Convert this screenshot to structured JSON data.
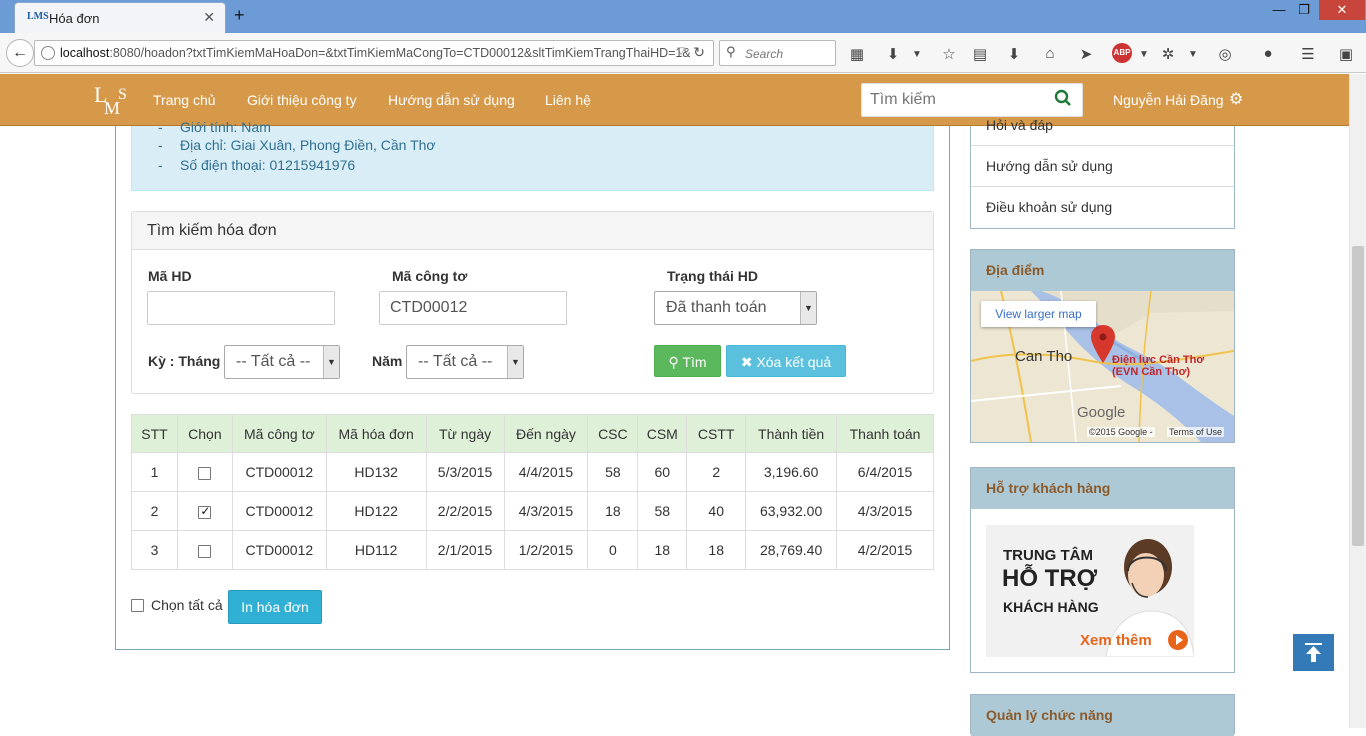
{
  "browser": {
    "tab_title": "Hóa đơn",
    "tab_favicon": "LMS",
    "url_host": "localhost",
    "url_rest": ":8080/hoadon?txtTimKiemMaHoaDon=&txtTimKiemMaCongTo=CTD00012&sltTimKiemTrangThaiHD=1&",
    "search_placeholder": "Search",
    "adblock_label": "ABP"
  },
  "header": {
    "nav": [
      "Trang chủ",
      "Giới thiệu công ty",
      "Hướng dẫn sử dụng",
      "Liên hệ"
    ],
    "search_placeholder": "Tìm kiếm",
    "user_name": "Nguyễn Hải Đăng"
  },
  "info": {
    "lines": [
      "Giới tính: Nam",
      "Địa chỉ: Giai Xuân, Phong Điền, Cần Thơ",
      "Số điện thoại: 01215941976"
    ]
  },
  "search_form": {
    "title": "Tìm kiếm hóa đơn",
    "ma_hd_label": "Mã HD",
    "ma_hd_value": "",
    "ma_cong_to_label": "Mã công tơ",
    "ma_cong_to_value": "CTD00012",
    "trang_thai_label": "Trạng thái HD",
    "trang_thai_value": "Đã thanh toán",
    "ky_label": "Kỳ : Tháng",
    "thang_value": "-- Tất cả --",
    "nam_label": "Năm",
    "nam_value": "-- Tất cả --",
    "search_button": "Tìm",
    "clear_button": "Xóa kết quả"
  },
  "table": {
    "headers": [
      "STT",
      "Chọn",
      "Mã công tơ",
      "Mã hóa đơn",
      "Từ ngày",
      "Đến ngày",
      "CSC",
      "CSM",
      "CSTT",
      "Thành tiền",
      "Thanh toán"
    ],
    "rows": [
      {
        "stt": "1",
        "checked": false,
        "ma_cong_to": "CTD00012",
        "ma_hoa_don": "HD132",
        "tu_ngay": "5/3/2015",
        "den_ngay": "4/4/2015",
        "csc": "58",
        "csm": "60",
        "cstt": "2",
        "thanh_tien": "3,196.60",
        "thanh_toan": "6/4/2015"
      },
      {
        "stt": "2",
        "checked": true,
        "ma_cong_to": "CTD00012",
        "ma_hoa_don": "HD122",
        "tu_ngay": "2/2/2015",
        "den_ngay": "4/3/2015",
        "csc": "18",
        "csm": "58",
        "cstt": "40",
        "thanh_tien": "63,932.00",
        "thanh_toan": "4/3/2015"
      },
      {
        "stt": "3",
        "checked": false,
        "ma_cong_to": "CTD00012",
        "ma_hoa_don": "HD112",
        "tu_ngay": "2/1/2015",
        "den_ngay": "1/2/2015",
        "csc": "0",
        "csm": "18",
        "cstt": "18",
        "thanh_tien": "28,769.40",
        "thanh_toan": "4/2/2015"
      }
    ],
    "select_all_label": "Chọn tất cả",
    "print_button": "In hóa đơn"
  },
  "sidebar": {
    "menu": [
      "Hỏi và đáp",
      "Hướng dẫn sử dụng",
      "Điều khoản sử dụng"
    ],
    "location_title": "Địa điểm",
    "map": {
      "larger_map": "View larger map",
      "city": "Can Tho",
      "place_line1": "Điện lực Cần Thơ",
      "place_line2": "(EVN Cần Thơ)",
      "brand": "Google",
      "copyright": "©2015 Google -",
      "terms": "Terms of Use"
    },
    "support_title": "Hỗ trợ khách hàng",
    "support_ad": {
      "line1": "TRUNG TÂM",
      "line2": "HỖ TRỢ",
      "line3": "KHÁCH HÀNG",
      "more": "Xem thêm"
    },
    "manage_title": "Quản lý chức năng"
  },
  "colors": {
    "header_bg": "#d6994a",
    "accent_green": "#5cb85c",
    "accent_cyan": "#5bc0de",
    "widget_head": "#aec9d6"
  }
}
